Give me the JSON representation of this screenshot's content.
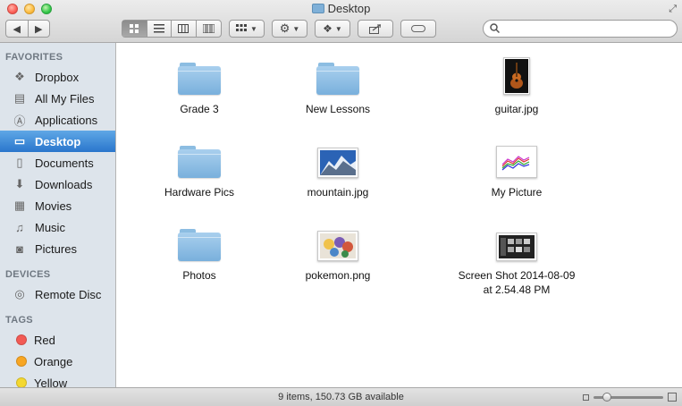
{
  "window": {
    "title": "Desktop"
  },
  "toolbar": {
    "back": "◀",
    "forward": "▶",
    "view_icon": "view-icons",
    "view_list": "view-list",
    "view_columns": "view-columns",
    "view_coverflow": "view-coverflow",
    "arrange": "arrange-menu",
    "action": "action-menu",
    "dropbox": "dropbox-menu",
    "share": "share-button",
    "tags": "tags-button",
    "search_placeholder": ""
  },
  "sidebar": {
    "favorites_header": "FAVORITES",
    "favorites": [
      {
        "label": "Dropbox",
        "icon": "dropbox-icon",
        "glyph": "❖"
      },
      {
        "label": "All My Files",
        "icon": "all-files-icon",
        "glyph": "▤"
      },
      {
        "label": "Applications",
        "icon": "applications-icon",
        "glyph": "Ⓐ"
      },
      {
        "label": "Desktop",
        "icon": "desktop-icon",
        "glyph": "▭",
        "selected": true
      },
      {
        "label": "Documents",
        "icon": "documents-icon",
        "glyph": "▯"
      },
      {
        "label": "Downloads",
        "icon": "downloads-icon",
        "glyph": "⬇"
      },
      {
        "label": "Movies",
        "icon": "movies-icon",
        "glyph": "▦"
      },
      {
        "label": "Music",
        "icon": "music-icon",
        "glyph": "♫"
      },
      {
        "label": "Pictures",
        "icon": "pictures-icon",
        "glyph": "◙"
      }
    ],
    "devices_header": "DEVICES",
    "devices": [
      {
        "label": "Remote Disc",
        "icon": "disc-icon",
        "glyph": "◎"
      }
    ],
    "tags_header": "TAGS",
    "tags": [
      {
        "label": "Red",
        "color": "#f25a54"
      },
      {
        "label": "Orange",
        "color": "#f8a623"
      },
      {
        "label": "Yellow",
        "color": "#f4d830"
      }
    ]
  },
  "files": [
    {
      "name": "Grade 3",
      "kind": "folder"
    },
    {
      "name": "New Lessons",
      "kind": "folder"
    },
    {
      "name": "guitar.jpg",
      "kind": "image-guitar"
    },
    {
      "name": "Hardware Pics",
      "kind": "folder"
    },
    {
      "name": "mountain.jpg",
      "kind": "image-mountain"
    },
    {
      "name": "My Picture",
      "kind": "image-chart"
    },
    {
      "name": "Photos",
      "kind": "folder"
    },
    {
      "name": "pokemon.png",
      "kind": "image-pokemon"
    },
    {
      "name": "Screen Shot 2014-08-09\nat 2.54.48 PM",
      "kind": "image-screenshot"
    }
  ],
  "status": {
    "text": "9 items, 150.73 GB available"
  }
}
